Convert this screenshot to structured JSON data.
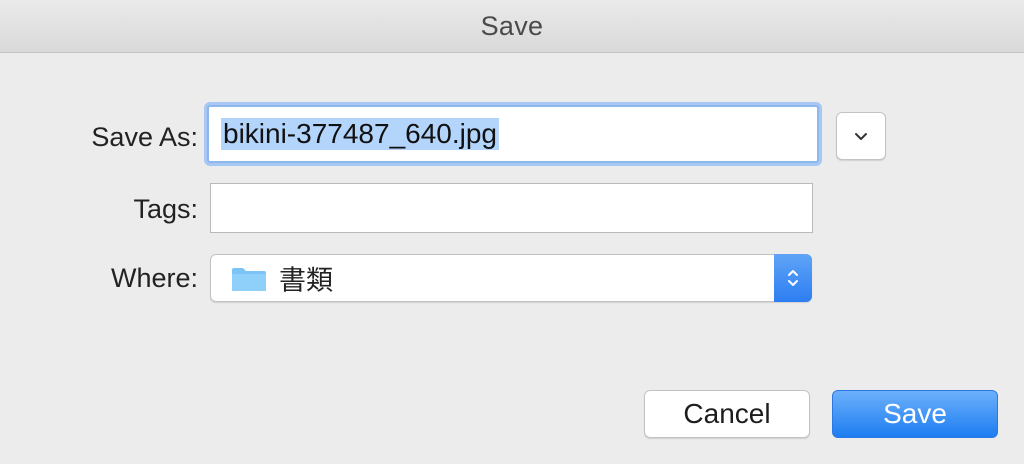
{
  "window": {
    "title": "Save"
  },
  "form": {
    "save_as_label": "Save As:",
    "save_as_value": "bikini-377487_640.jpg",
    "tags_label": "Tags:",
    "tags_value": "",
    "where_label": "Where:",
    "where_value": "書類",
    "where_icon": "folder-icon",
    "expand_icon": "chevron-down-icon",
    "stepper_icon": "up-down-chevron-icon"
  },
  "buttons": {
    "cancel_label": "Cancel",
    "save_label": "Save"
  },
  "colors": {
    "accent": "#2c7ef2",
    "selection": "#b3d4fb",
    "folder": "#7cc4f5"
  }
}
